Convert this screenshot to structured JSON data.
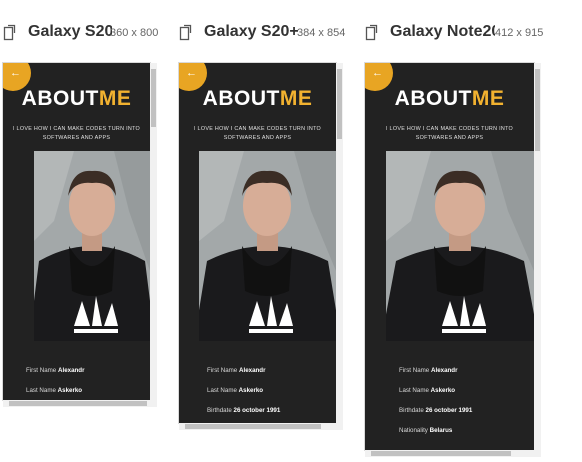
{
  "devices": [
    {
      "name": "Galaxy S20",
      "size": "360 x 800",
      "screen": {
        "back_arrow": "←",
        "title_main": "ABOUT",
        "title_accent": "ME",
        "tagline": "I LOVE HOW I CAN MAKE CODES TURN INTO SOFTWARES AND APPS",
        "info": [
          {
            "label": "First Name",
            "value": "Alexandr"
          },
          {
            "label": "Last Name",
            "value": "Askerko"
          }
        ]
      }
    },
    {
      "name": "Galaxy S20+",
      "size": "384 x 854",
      "screen": {
        "back_arrow": "←",
        "title_main": "ABOUT",
        "title_accent": "ME",
        "tagline": "I LOVE HOW I CAN MAKE CODES TURN INTO SOFTWARES AND APPS",
        "info": [
          {
            "label": "First Name",
            "value": "Alexandr"
          },
          {
            "label": "Last Name",
            "value": "Askerko"
          },
          {
            "label": "Birthdate",
            "value": "26 october 1991"
          }
        ]
      }
    },
    {
      "name": "Galaxy Note20",
      "size": "412 x 915",
      "screen": {
        "back_arrow": "←",
        "title_main": "ABOUT",
        "title_accent": "ME",
        "tagline": "I LOVE HOW I CAN MAKE CODES TURN INTO SOFTWARES AND APPS",
        "info": [
          {
            "label": "First Name",
            "value": "Alexandr"
          },
          {
            "label": "Last Name",
            "value": "Askerko"
          },
          {
            "label": "Birthdate",
            "value": "26 october 1991"
          },
          {
            "label": "Nationality",
            "value": "Belarus"
          }
        ]
      }
    }
  ],
  "colors": {
    "screen_bg": "#222222",
    "accent": "#f2b230",
    "back_button": "#e8a523"
  },
  "icons": {
    "rotate": "rotate-device-icon",
    "back": "back-arrow-icon"
  }
}
